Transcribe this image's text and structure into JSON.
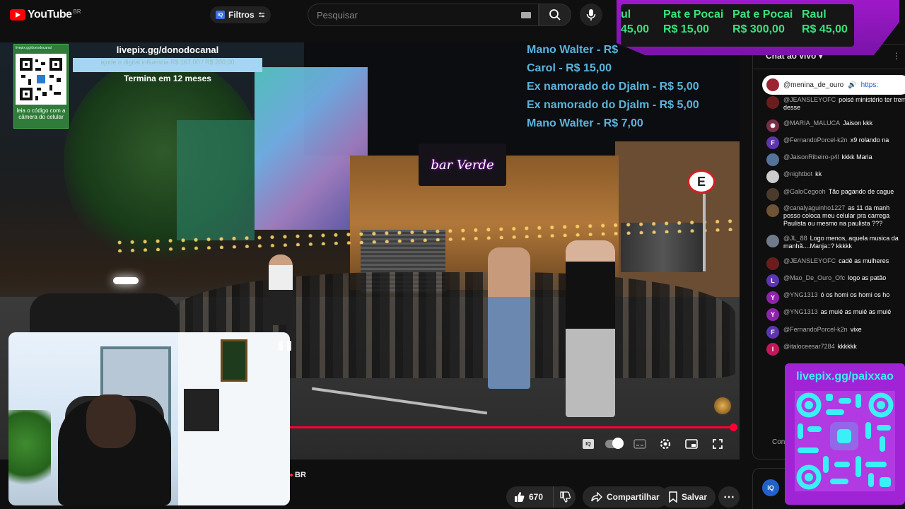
{
  "topbar": {
    "logo_text": "YouTube",
    "logo_region": "BR",
    "filter_label": "Filtros",
    "search_placeholder": "Pesquisar"
  },
  "donor_banner": [
    {
      "name": "ul",
      "amount": "45,00"
    },
    {
      "name": "Pat e Pocai",
      "amount": "R$ 15,00"
    },
    {
      "name": "Pat e Pocai",
      "amount": "R$ 300,00"
    },
    {
      "name": "Raul",
      "amount": "R$ 45,00"
    }
  ],
  "overlay": {
    "qr_hint": "livepix.gg/donodocanal",
    "qr_caption": "leia o código com a câmera do celular",
    "livepix_url": "livepix.gg/donodocanal",
    "livepix_sub": "ajude o digital influencia R$ 167,00 / R$ 200,00",
    "livepix_end": "Termina em 12 meses",
    "bar_sign": "bar Verde",
    "street_sign": "E",
    "donations": [
      "Mano Walter - R$",
      "Carol - R$ 15,00",
      "Ex namorado do Djalm - R$ 5,00",
      "Ex namorado do Djalm - R$ 5,00",
      "Mano Walter - R$ 7,00"
    ]
  },
  "video": {
    "progress": 0.99,
    "region_label": "BR"
  },
  "actions": {
    "likes": "670",
    "share": "Compartilhar",
    "save": "Salvar",
    "more": "⋯"
  },
  "chat": {
    "title": "Chat ao vivo",
    "pinned_user": "@menina_de_ouro",
    "pinned_link": "https:",
    "input_placeholder": "Con",
    "messages": [
      {
        "user": "@JEANSLEYOFC",
        "text": "poisé ministério ter trem desse",
        "avatar": "",
        "color": "#6b1d1d"
      },
      {
        "user": "@MARIA_MALUCA",
        "text": "Jaison kkk",
        "avatar": "✺",
        "color": "#7a2e48"
      },
      {
        "user": "@FernandoPorcel-k2n",
        "text": "x9 rolando na",
        "avatar": "F",
        "color": "#5e35b1"
      },
      {
        "user": "@JaisonRibeiro-p4l",
        "text": "kkkk Maria",
        "avatar": "",
        "color": "#55729a"
      },
      {
        "user": "@nightbot",
        "text": "kk",
        "avatar": "",
        "color": "#cccccc"
      },
      {
        "user": "@GaloCegooh",
        "text": "Tão pagando de cague",
        "avatar": "",
        "color": "#4a3b2d"
      },
      {
        "user": "@canalyaguinho1227",
        "text": "as 11 da manh posso coloca meu celular pra carrega Paulista ou mesmo na paulista ???",
        "avatar": "",
        "color": "#6f5335"
      },
      {
        "user": "@JL_88",
        "text": "Logo menos, aquela musica da manhã....Manja::? kkkkk",
        "avatar": "",
        "color": "#6f7a8a"
      },
      {
        "user": "@JEANSLEYOFC",
        "text": "cadê as mulheres",
        "avatar": "",
        "color": "#6b1d1d"
      },
      {
        "user": "@Mao_De_Ouro_Ofc",
        "text": "logo as patão",
        "avatar": "L",
        "color": "#5e35b1"
      },
      {
        "user": "@YNG1313",
        "text": "ó os homi os homi os ho",
        "avatar": "Y",
        "color": "#8e24aa"
      },
      {
        "user": "@YNG1313",
        "text": "as muié as muié as muié",
        "avatar": "Y",
        "color": "#8e24aa"
      },
      {
        "user": "@FernandoPorcel-k2n",
        "text": "vixe",
        "avatar": "F",
        "color": "#5e35b1"
      },
      {
        "user": "@italoceesar7284",
        "text": "kkkkkk",
        "avatar": "I",
        "color": "#c2185b"
      }
    ]
  },
  "livepix_qr": {
    "title": "livepix.gg/paixxao"
  },
  "icons": {
    "search": "search-icon",
    "mic": "mic-icon",
    "like": "thumbs-up-icon",
    "dislike": "thumbs-down-icon",
    "share": "share-icon",
    "save": "bookmark-icon"
  }
}
